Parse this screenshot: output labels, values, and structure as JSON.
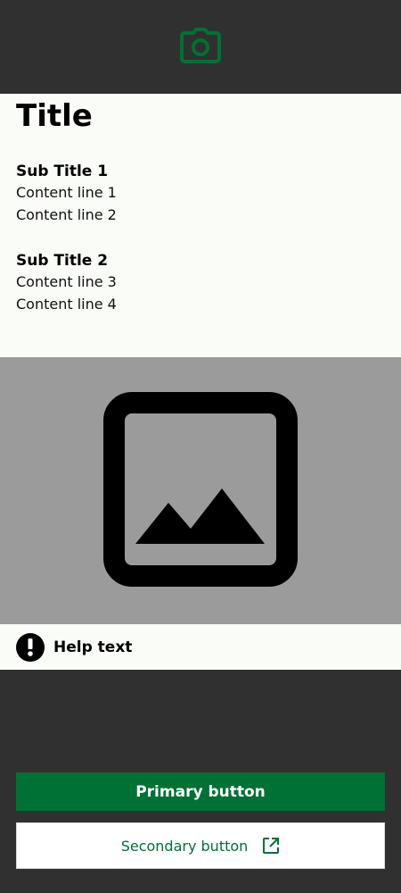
{
  "colors": {
    "background": "#303030",
    "panel": "#fafcf7",
    "accent": "#007135",
    "image_placeholder": "#9b9b9b"
  },
  "header": {
    "icon": "camera-icon"
  },
  "content": {
    "title": "Title",
    "sections": [
      {
        "subtitle": "Sub Title 1",
        "lines": [
          "Content line 1",
          "Content line 2"
        ]
      },
      {
        "subtitle": "Sub Title 2",
        "lines": [
          "Content line 3",
          "Content line 4"
        ]
      }
    ]
  },
  "image": {
    "icon": "image-placeholder-icon"
  },
  "help": {
    "icon": "alert-icon",
    "text": "Help text"
  },
  "buttons": {
    "primary_label": "Primary button",
    "secondary_label": "Secondary button",
    "secondary_icon": "external-link-icon"
  }
}
